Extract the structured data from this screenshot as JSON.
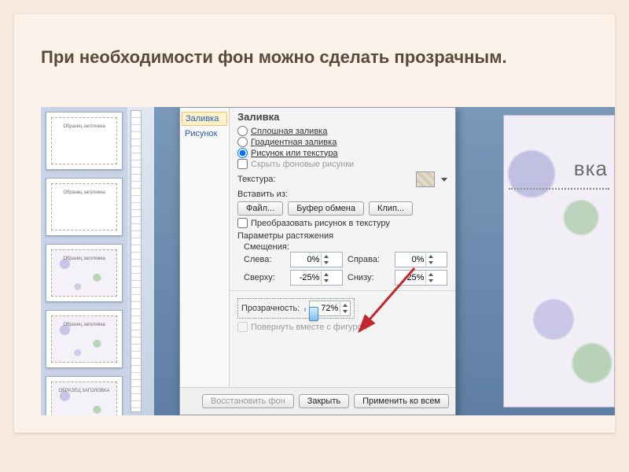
{
  "title": "При необходимости фон можно сделать прозрачным.",
  "thumbs": [
    {
      "caption": "Образец заголовка"
    },
    {
      "caption": "Образец заголовка"
    },
    {
      "caption": "Образец заголовка"
    },
    {
      "caption": "Образец заголовка"
    },
    {
      "caption": "ОБРАЗЕЦ ЗАГОЛОВКА"
    }
  ],
  "slidepeek": {
    "text_fragment": "вка"
  },
  "dialog": {
    "nav": {
      "items": [
        "Заливка",
        "Рисунок"
      ],
      "selected": 0
    },
    "heading": "Заливка",
    "fill_options": {
      "solid": "Сплошная заливка",
      "gradient": "Градиентная заливка",
      "picture": "Рисунок или текстура",
      "hide_bg": "Скрыть фоновые рисунки",
      "selected": "picture",
      "hide_bg_checked": false
    },
    "texture_label": "Текстура:",
    "insert_from_label": "Вставить из:",
    "insert_buttons": {
      "file": "Файл...",
      "clipboard": "Буфер обмена",
      "clip": "Клип..."
    },
    "tile_checkbox": {
      "label": "Преобразовать рисунок в текстуру",
      "checked": false
    },
    "stretch_heading": "Параметры растяжения",
    "offsets_label": "Смещения:",
    "offsets": {
      "left_label": "Слева:",
      "left_value": "0%",
      "right_label": "Справа:",
      "right_value": "0%",
      "top_label": "Сверху:",
      "top_value": "-25%",
      "bottom_label": "Снизу:",
      "bottom_value": "-25%"
    },
    "transparency": {
      "label": "Прозрачность:",
      "value": "72%",
      "slider_pct": 72
    },
    "rotate_checkbox": {
      "label": "Повернуть вместе с фигурой",
      "checked": false,
      "enabled": false
    },
    "footer": {
      "reset": "Восстановить фон",
      "close": "Закрыть",
      "apply_all": "Применить ко всем"
    }
  }
}
